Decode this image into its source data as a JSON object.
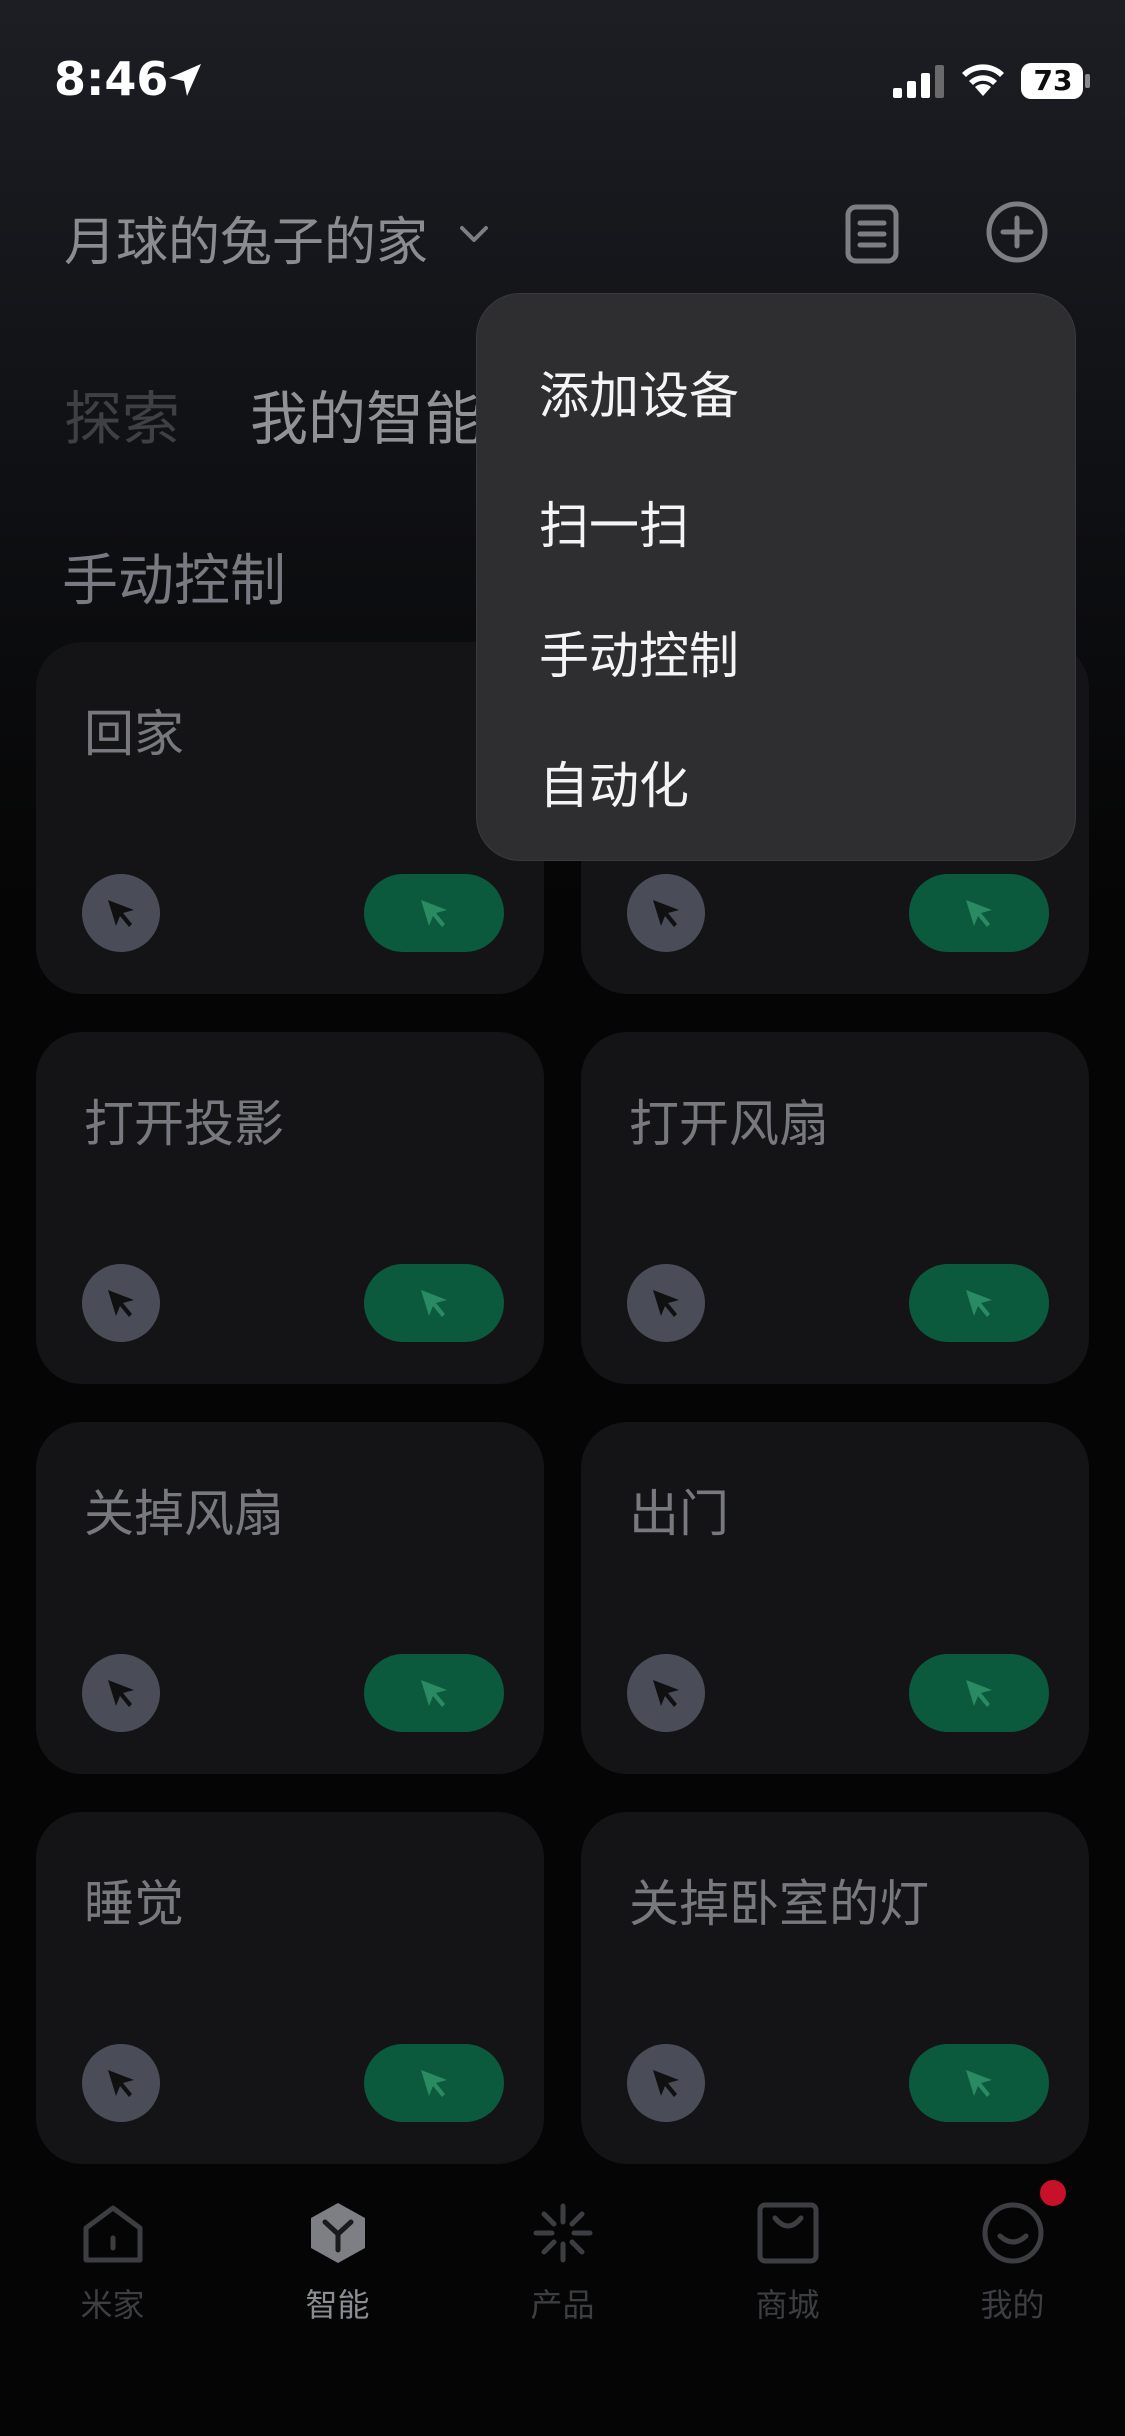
{
  "status_bar": {
    "time": "8:46",
    "battery": "73"
  },
  "header": {
    "home_name": "月球的兔子的家"
  },
  "tabs": [
    {
      "label": "探索"
    },
    {
      "label": "我的智能"
    }
  ],
  "section": {
    "title": "手动控制"
  },
  "scenes": [
    {
      "name": "回家"
    },
    {
      "name": ""
    },
    {
      "name": "打开投影"
    },
    {
      "name": "打开风扇"
    },
    {
      "name": "关掉风扇"
    },
    {
      "name": "出门"
    },
    {
      "name": "睡觉"
    },
    {
      "name": "关掉卧室的灯"
    }
  ],
  "menu": {
    "items": [
      {
        "label": "添加设备"
      },
      {
        "label": "扫一扫"
      },
      {
        "label": "手动控制"
      },
      {
        "label": "自动化"
      }
    ]
  },
  "bottom_nav": {
    "items": [
      {
        "label": "米家",
        "icon": "home-icon"
      },
      {
        "label": "智能",
        "icon": "smart-cube-icon",
        "active": true
      },
      {
        "label": "产品",
        "icon": "spark-icon"
      },
      {
        "label": "商城",
        "icon": "shopping-bag-icon"
      },
      {
        "label": "我的",
        "icon": "profile-face-icon"
      }
    ]
  },
  "colors": {
    "accent_green": "#0b5a3d",
    "badge_red": "#c8102a",
    "menu_bg": "#2e2e31"
  }
}
